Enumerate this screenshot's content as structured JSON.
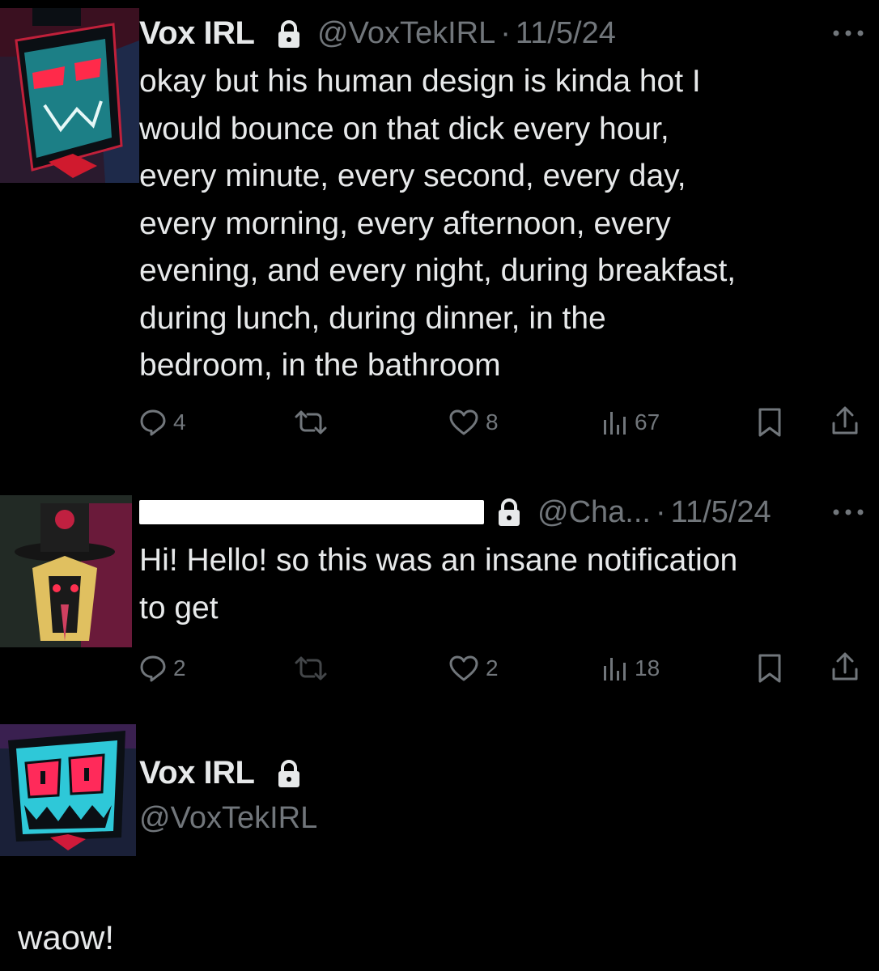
{
  "colors": {
    "background": "#000000",
    "text": "#e7e9ea",
    "muted": "#71767b"
  },
  "tweet1": {
    "name": "Vox IRL",
    "handle": "@VoxTekIRL",
    "sep": "·",
    "date": "11/5/24",
    "body": "okay but his human design is kinda hot I\nwould bounce on that dick every hour,\nevery minute, every second, every day,\nevery morning, every afternoon, every\nevening, and every night, during breakfast,\nduring lunch, during dinner, in the\nbedroom, in the bathroom",
    "replies": "4",
    "likes": "8",
    "views": "67"
  },
  "tweet2": {
    "handle": "@Cha...",
    "sep": "·",
    "date": "11/5/24",
    "body": "Hi! Hello! so this was an insane notification\nto get",
    "replies": "2",
    "likes": "2",
    "views": "18"
  },
  "tweet3": {
    "name": "Vox IRL",
    "handle": "@VoxTekIRL",
    "body": "waow!"
  },
  "icons": [
    "more-icon",
    "lock-icon",
    "reply-icon",
    "retweet-icon",
    "like-icon",
    "views-icon",
    "bookmark-icon",
    "share-icon"
  ]
}
